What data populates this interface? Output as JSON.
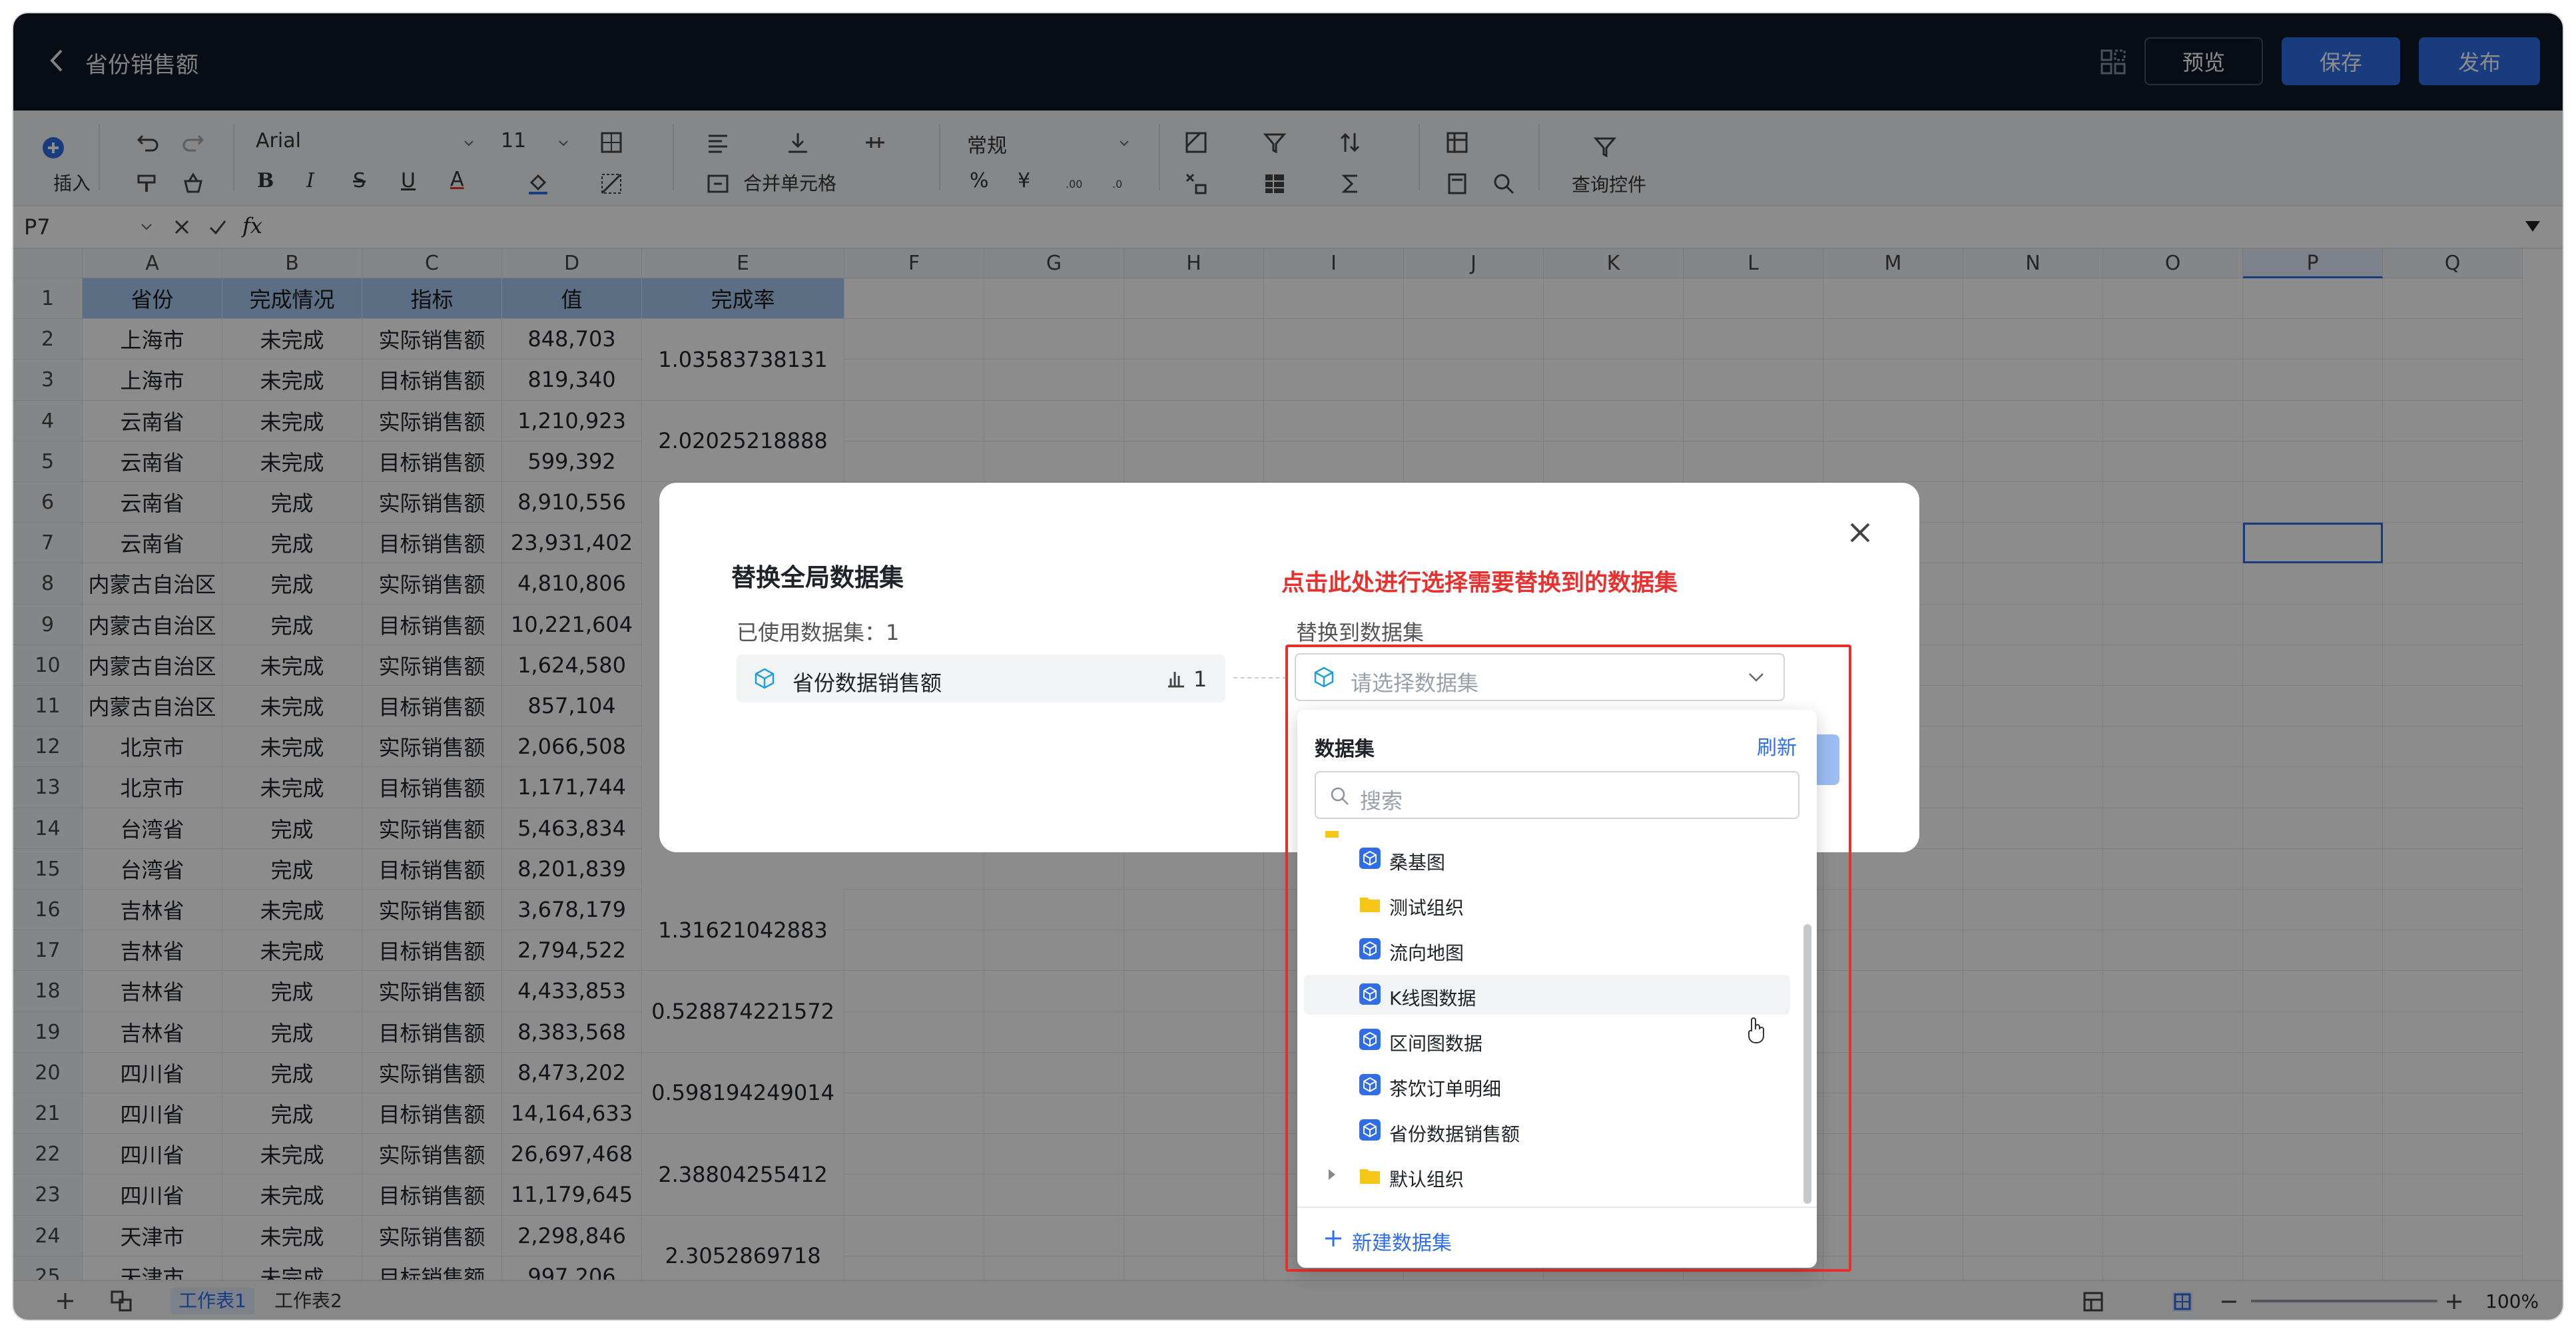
{
  "topbar": {
    "title": "省份销售额",
    "preview_label": "预览",
    "save_label": "保存",
    "publish_label": "发布"
  },
  "toolbar": {
    "insert_label": "插入",
    "font_name": "Arial",
    "font_size": "11",
    "number_format": "常规",
    "merge_label": "合并单元格",
    "query_control_label": "查询控件",
    "percent": "%",
    "currency": "¥"
  },
  "formula_bar": {
    "cell_ref": "P7",
    "fx": "fx"
  },
  "grid": {
    "columns": [
      "A",
      "B",
      "C",
      "D",
      "E",
      "F",
      "G",
      "H",
      "I",
      "J",
      "K",
      "L",
      "M",
      "N",
      "O",
      "P",
      "Q"
    ],
    "row_numbers": [
      "1",
      "2",
      "3",
      "4",
      "5",
      "6",
      "7",
      "8",
      "9",
      "10",
      "11",
      "12",
      "13",
      "14",
      "15",
      "16",
      "17",
      "18",
      "19",
      "20",
      "21",
      "22",
      "23",
      "24",
      "25"
    ],
    "header_row": [
      "省份",
      "完成情况",
      "指标",
      "值",
      "完成率"
    ],
    "rows": [
      [
        "上海市",
        "未完成",
        "实际销售额",
        "848,703"
      ],
      [
        "上海市",
        "未完成",
        "目标销售额",
        "819,340"
      ],
      [
        "云南省",
        "未完成",
        "实际销售额",
        "1,210,923"
      ],
      [
        "云南省",
        "未完成",
        "目标销售额",
        "599,392"
      ],
      [
        "云南省",
        "完成",
        "实际销售额",
        "8,910,556"
      ],
      [
        "云南省",
        "完成",
        "目标销售额",
        "23,931,402"
      ],
      [
        "内蒙古自治区",
        "完成",
        "实际销售额",
        "4,810,806"
      ],
      [
        "内蒙古自治区",
        "完成",
        "目标销售额",
        "10,221,604"
      ],
      [
        "内蒙古自治区",
        "未完成",
        "实际销售额",
        "1,624,580"
      ],
      [
        "内蒙古自治区",
        "未完成",
        "目标销售额",
        "857,104"
      ],
      [
        "北京市",
        "未完成",
        "实际销售额",
        "2,066,508"
      ],
      [
        "北京市",
        "未完成",
        "目标销售额",
        "1,171,744"
      ],
      [
        "台湾省",
        "完成",
        "实际销售额",
        "5,463,834"
      ],
      [
        "台湾省",
        "完成",
        "目标销售额",
        "8,201,839"
      ],
      [
        "吉林省",
        "未完成",
        "实际销售额",
        "3,678,179"
      ],
      [
        "吉林省",
        "未完成",
        "目标销售额",
        "2,794,522"
      ],
      [
        "吉林省",
        "完成",
        "实际销售额",
        "4,433,853"
      ],
      [
        "吉林省",
        "完成",
        "目标销售额",
        "8,383,568"
      ],
      [
        "四川省",
        "完成",
        "实际销售额",
        "8,473,202"
      ],
      [
        "四川省",
        "完成",
        "目标销售额",
        "14,164,633"
      ],
      [
        "四川省",
        "未完成",
        "实际销售额",
        "26,697,468"
      ],
      [
        "四川省",
        "未完成",
        "目标销售额",
        "11,179,645"
      ],
      [
        "天津市",
        "未完成",
        "实际销售额",
        "2,298,846"
      ],
      [
        "天津市",
        "未完成",
        "目标销售额",
        "997,206"
      ]
    ],
    "rates": [
      "1.03583738131",
      "2.02025218888",
      "1.31621042883",
      "0.528874221572",
      "0.598194249014",
      "2.38804255412",
      "2.3052869718"
    ]
  },
  "sheets": {
    "tabs": [
      "工作表1",
      "工作表2"
    ],
    "zoom": "100%"
  },
  "dialog": {
    "title": "替换全局数据集",
    "hint": "点击此处进行选择需要替换到的数据集",
    "used_label": "已使用数据集：1",
    "used_item_name": "省份数据销售额",
    "used_item_count": "1",
    "replace_label": "替换到数据集",
    "select_placeholder": "请选择数据集"
  },
  "dropdown": {
    "title": "数据集",
    "refresh": "刷新",
    "search_placeholder": "搜索",
    "items": [
      {
        "label": "桑基图",
        "type": "dataset"
      },
      {
        "label": "测试组织",
        "type": "folder"
      },
      {
        "label": "流向地图",
        "type": "dataset"
      },
      {
        "label": "K线图数据",
        "type": "dataset"
      },
      {
        "label": "区间图数据",
        "type": "dataset"
      },
      {
        "label": "茶饮订单明细",
        "type": "dataset"
      },
      {
        "label": "省份数据销售额",
        "type": "dataset"
      },
      {
        "label": "默认组织",
        "type": "folder"
      }
    ],
    "new_label": "新建数据集"
  },
  "colors": {
    "topbar_bg": "#0f1726",
    "accent": "#2f6ee8",
    "header_fill": "#a8c8ee",
    "hint_red": "#e8302e"
  }
}
